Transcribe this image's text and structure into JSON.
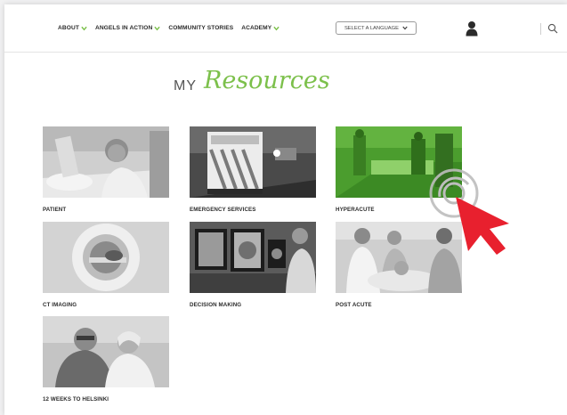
{
  "nav": {
    "items": [
      {
        "label": "ABOUT",
        "dropdown": true
      },
      {
        "label": "ANGELS IN ACTION",
        "dropdown": true
      },
      {
        "label": "COMMUNITY STORIES",
        "dropdown": false
      },
      {
        "label": "ACADEMY",
        "dropdown": true
      }
    ],
    "language_select": "SELECT A LANGUAGE",
    "user_icon": "user-icon",
    "search_icon": "search-icon"
  },
  "heading": {
    "prefix": "MY",
    "title": "Resources"
  },
  "resources": [
    {
      "label": "PATIENT",
      "image": "patient-in-hospital-bed"
    },
    {
      "label": "EMERGENCY SERVICES",
      "image": "ambulance"
    },
    {
      "label": "HYPERACUTE",
      "image": "stretcher-in-corridor-green"
    },
    {
      "label": "CT IMAGING",
      "image": "ct-scanner"
    },
    {
      "label": "DECISION MAKING",
      "image": "doctor-viewing-brain-scans"
    },
    {
      "label": "POST ACUTE",
      "image": "nurse-with-patient"
    },
    {
      "label": "12 WEEKS TO HELSINKI",
      "image": "elderly-couple"
    }
  ],
  "colors": {
    "accent_green": "#7cc04b",
    "cursor_red": "#e8202e",
    "text_dark": "#2b2b2b"
  }
}
